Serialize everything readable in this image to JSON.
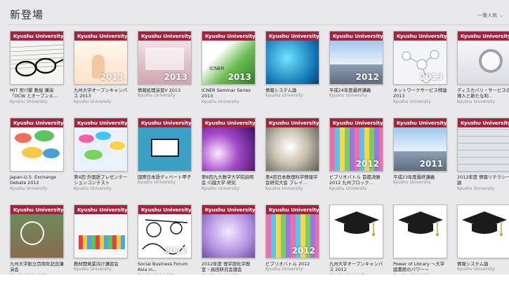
{
  "header": {
    "title": "新登場",
    "sort_label": "一番人気",
    "sort_icon": "chevron-down"
  },
  "publisher_band": "Kyushu University",
  "items": [
    {
      "title": "MIT 宮川繁 教授 講演「OCW とオープンエ…",
      "provider": "Kyushu University",
      "band": "#a8213c",
      "icon": "glasses-on-paper"
    },
    {
      "title": "九州大学オープンキャンパス 2013",
      "provider": "Kyushu University",
      "year": "2013",
      "band": "#a8213c",
      "icon": "hand-raised"
    },
    {
      "title": "情報処理演習V 2013",
      "provider": "Kyushu University",
      "year": "2013",
      "band": "#a8213c",
      "icon": "pink-panel"
    },
    {
      "title": "ICNER Seminar Series 2013",
      "provider": "Kyushu University",
      "year": "2013",
      "band": "#a8213c",
      "icon": "green-leaf-logo"
    },
    {
      "title": "情報システム論",
      "provider": "Kyushu University",
      "band": "#a8213c",
      "icon": "blue-network"
    },
    {
      "title": "平成24年度最終講義",
      "provider": "Kyushu University",
      "year": "2012",
      "band": "#a8213c",
      "icon": "sky-building"
    },
    {
      "title": "ネットワークサービス特論 2013",
      "provider": "Kyushu University",
      "year": "2013",
      "band": "#a8213c",
      "icon": "molecule-network"
    },
    {
      "title": "ディスカバリ・サービスの導入と新たな利…",
      "provider": "Kyushu University",
      "band": "#a8213c",
      "icon": "magnifier-service"
    },
    {
      "title": "Japan-U.S. Exchange Debate 2012",
      "provider": "Kyushu University",
      "band": "#a8213c",
      "icon": "speech-bubbles"
    },
    {
      "title": "第4回 外国語プレゼンテーションコンテスト",
      "provider": "Kyushu University",
      "band": "#a8213c",
      "icon": "colorful-bubbles"
    },
    {
      "title": "国際日本語ディベート甲子",
      "provider": "Kyushu University",
      "band": "#a8213c",
      "icon": "podium-speakers"
    },
    {
      "title": "第8回九大数学大学院説明会 川越大学 研究",
      "provider": "Kyushu University",
      "band": "#a8213c",
      "icon": "purple-rays"
    },
    {
      "title": "第4回日本数理科学情報学会研究大会 プレイ…",
      "provider": "Kyushu University",
      "band": "#a8213c",
      "icon": "light-rays"
    },
    {
      "title": "ビブリオバトル 首都決勝 2012 九州ブロック…",
      "provider": "Kyushu University",
      "year": "2012",
      "band": "#a8213c",
      "icon": "book-spines"
    },
    {
      "title": "平成23年度最終講義",
      "provider": "Kyushu University",
      "year": "2011",
      "band": "#a8213c",
      "icon": "sky-building"
    },
    {
      "title": "2012年度 情報リテラシー論",
      "provider": "Kyushu University",
      "band": "#a8213c",
      "icon": "keyboard"
    },
    {
      "title": "九州大学創立百周年記念講演会",
      "provider": "Kyushu University",
      "band": "#a8213c",
      "icon": "old-building"
    },
    {
      "title": "教材開発業向け講習会",
      "provider": "Kyushu University",
      "band": "#a8213c",
      "icon": "pencils"
    },
    {
      "title": "Social Business Forum Asia in…",
      "provider": "Kyushu University",
      "year": "2012",
      "band": "#a8213c",
      "icon": "doodle"
    },
    {
      "title": "2012年度 理学部化学教室・高田研究会議会",
      "provider": "Kyushu University",
      "band": "#a8213c",
      "icon": "bubbles-violet"
    },
    {
      "title": "ビブリオバトル 2012",
      "provider": "Kyushu University",
      "year": "2012",
      "band": "#a8213c",
      "icon": "book-spines"
    },
    {
      "title": "九州大学オープンキャンパス 2012",
      "provider": "Kyushu University",
      "icon": "graduation-cap"
    },
    {
      "title": "Power of Library 〜大学図書館のパワー〜",
      "provider": "Kyushu University",
      "icon": "graduation-cap"
    },
    {
      "title": "情報システム論",
      "provider": "Kyushu University",
      "icon": "graduation-cap"
    }
  ]
}
